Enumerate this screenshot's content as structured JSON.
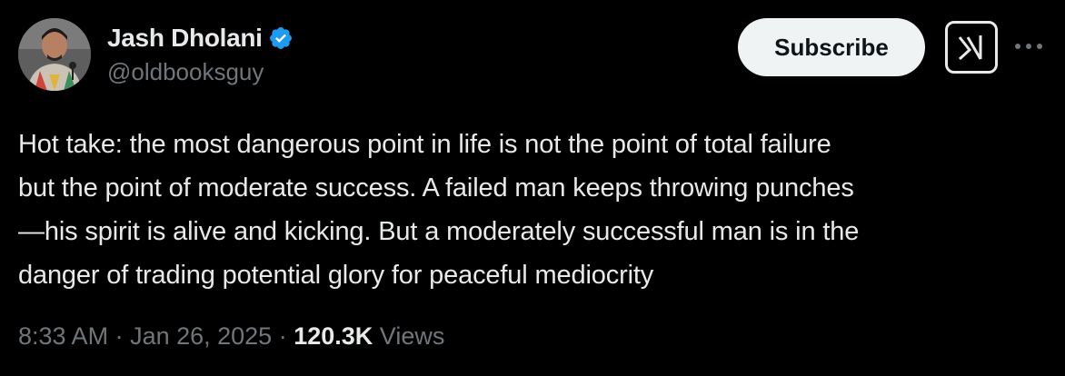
{
  "author": {
    "display_name": "Jash Dholani",
    "handle": "@oldbooksguy",
    "verified": true,
    "verified_color": "#1d9bf0"
  },
  "actions": {
    "subscribe_label": "Subscribe",
    "grok_icon": "grok-icon",
    "more_icon": "more-icon"
  },
  "tweet": {
    "text": "Hot take: the most dangerous point in life is not the point of total failure\nbut the point of moderate success. A failed man keeps throwing punches\n—his spirit is alive and kicking. But a moderately successful man is in the\ndanger of trading potential glory for peaceful mediocrity",
    "time": "8:33 AM",
    "separator": " · ",
    "date": "Jan 26, 2025",
    "views_count": "120.3K",
    "views_label": "Views"
  },
  "colors": {
    "background": "#000000",
    "primary_text": "#e7e9ea",
    "secondary_text": "#71767b",
    "button_bg": "#eff3f4"
  }
}
